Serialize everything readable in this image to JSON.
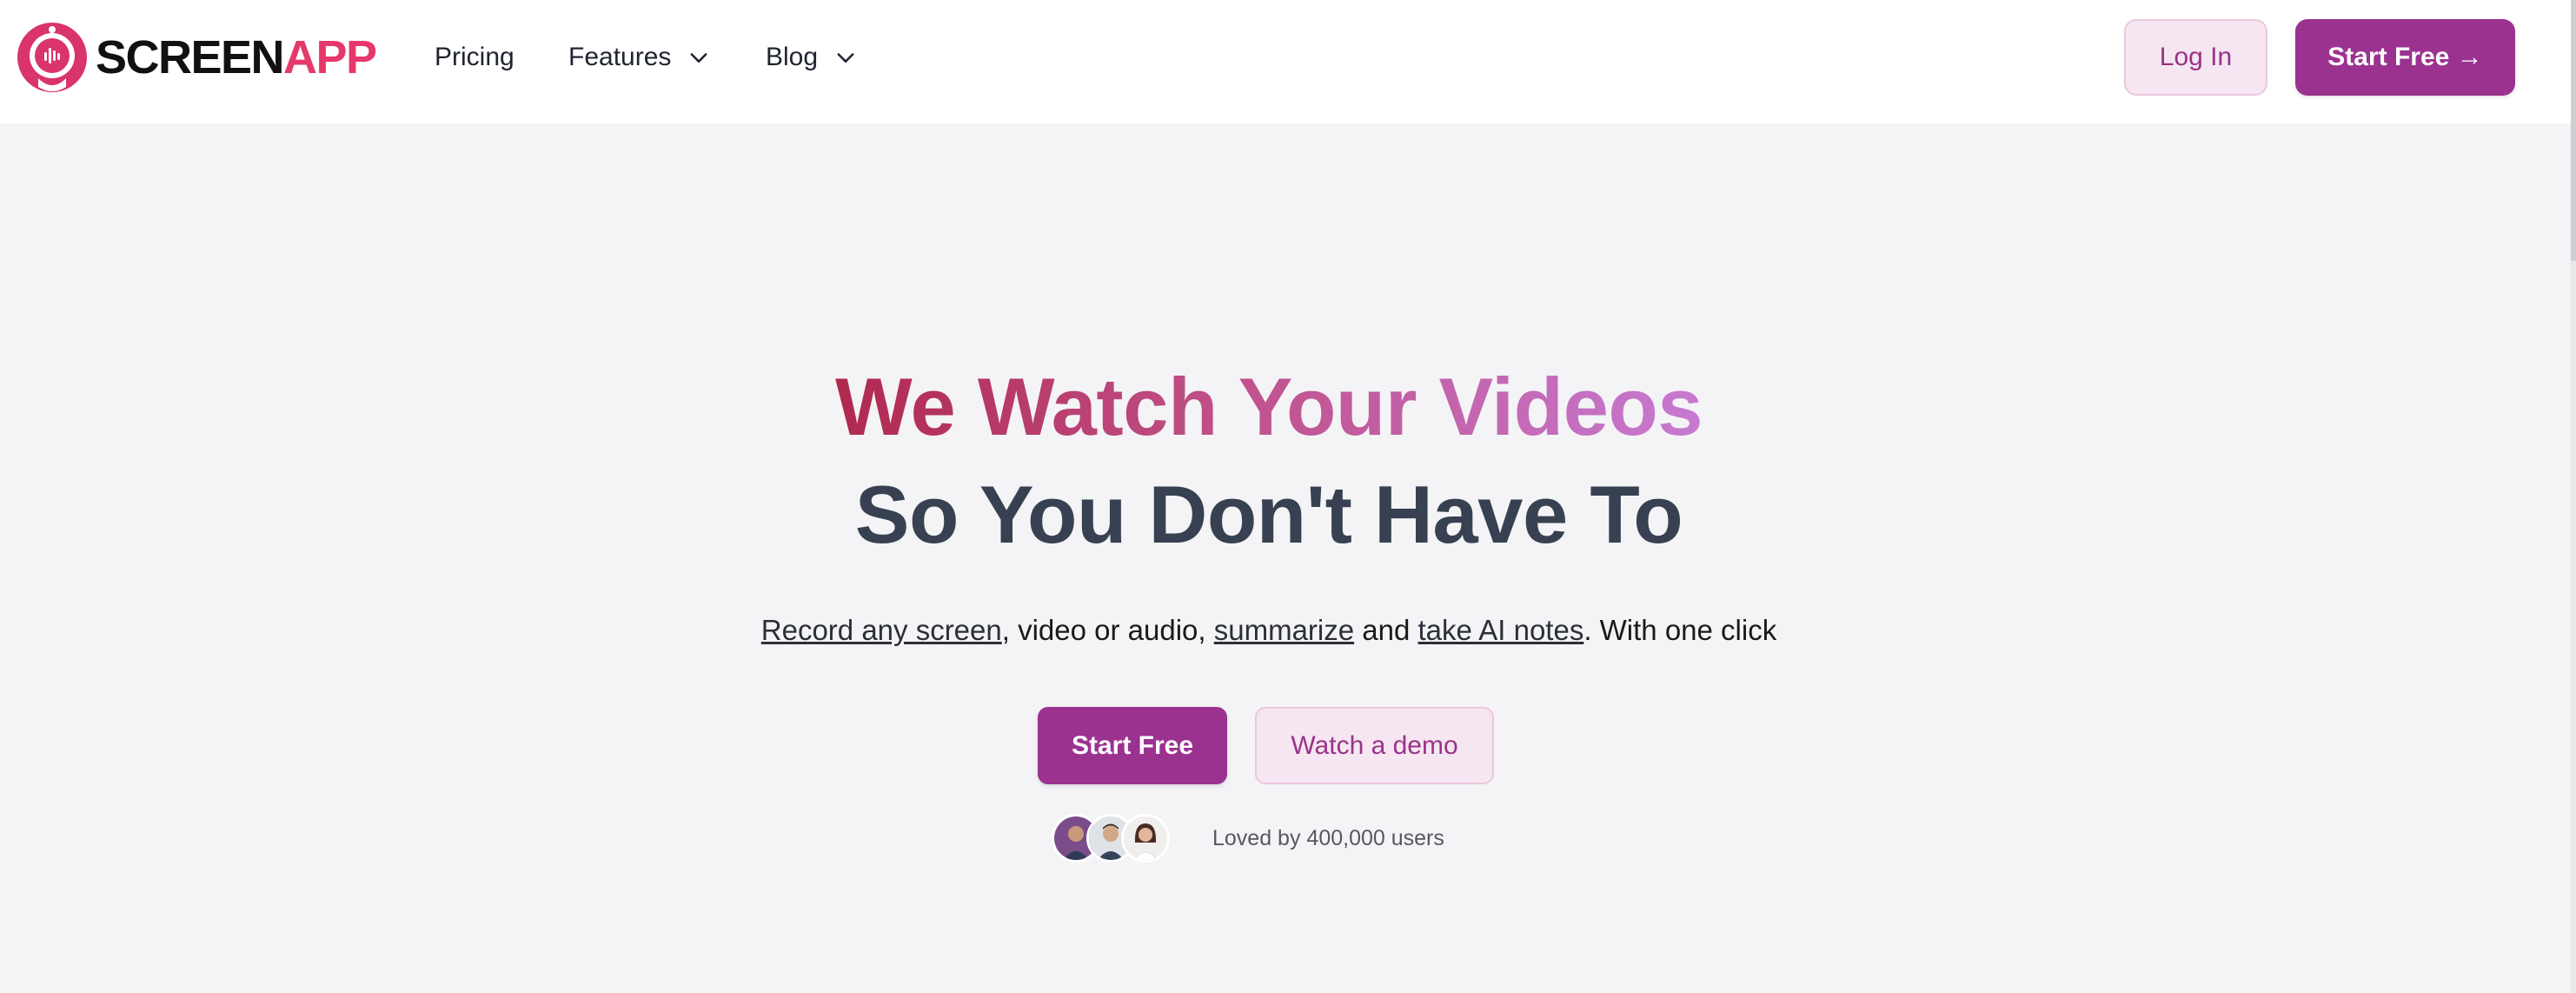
{
  "brand": {
    "name_part1": "SCREEN",
    "name_part2": "APP",
    "primary_color": "#9b3290",
    "accent_color": "#e5386b"
  },
  "nav": {
    "items": [
      {
        "label": "Pricing",
        "has_dropdown": false
      },
      {
        "label": "Features",
        "has_dropdown": true
      },
      {
        "label": "Blog",
        "has_dropdown": true
      }
    ],
    "login_label": "Log In",
    "start_label": "Start Free →"
  },
  "hero": {
    "title_line1": "We Watch Your Videos",
    "title_line2": "So You Don't Have To",
    "subtitle": {
      "link1": "Record any screen",
      "text1": ", video or audio, ",
      "link2": "summarize",
      "text2": " and ",
      "link3": "take AI notes",
      "text3": ". With one click"
    },
    "cta_primary": "Start Free",
    "cta_secondary": "Watch a demo",
    "social_proof": "Loved by 400,000 users",
    "avatars": [
      "avatar-1",
      "avatar-2",
      "avatar-3"
    ]
  },
  "icons": {
    "logo": "robot-mic-logo-icon",
    "dropdown": "chevron-down-icon"
  }
}
